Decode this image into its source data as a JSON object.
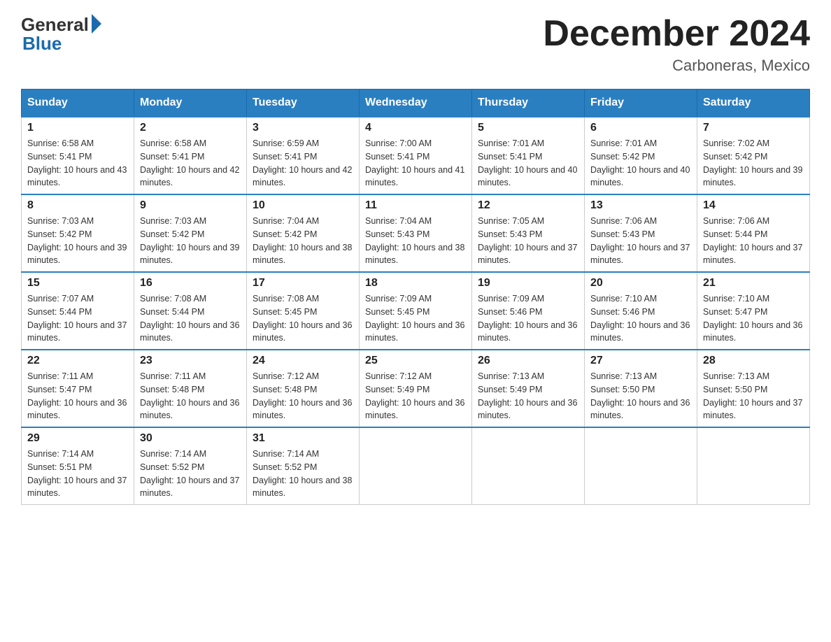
{
  "logo": {
    "general": "General",
    "blue": "Blue"
  },
  "title": "December 2024",
  "subtitle": "Carboneras, Mexico",
  "days_of_week": [
    "Sunday",
    "Monday",
    "Tuesday",
    "Wednesday",
    "Thursday",
    "Friday",
    "Saturday"
  ],
  "weeks": [
    [
      {
        "day": "1",
        "sunrise": "6:58 AM",
        "sunset": "5:41 PM",
        "daylight": "10 hours and 43 minutes."
      },
      {
        "day": "2",
        "sunrise": "6:58 AM",
        "sunset": "5:41 PM",
        "daylight": "10 hours and 42 minutes."
      },
      {
        "day": "3",
        "sunrise": "6:59 AM",
        "sunset": "5:41 PM",
        "daylight": "10 hours and 42 minutes."
      },
      {
        "day": "4",
        "sunrise": "7:00 AM",
        "sunset": "5:41 PM",
        "daylight": "10 hours and 41 minutes."
      },
      {
        "day": "5",
        "sunrise": "7:01 AM",
        "sunset": "5:41 PM",
        "daylight": "10 hours and 40 minutes."
      },
      {
        "day": "6",
        "sunrise": "7:01 AM",
        "sunset": "5:42 PM",
        "daylight": "10 hours and 40 minutes."
      },
      {
        "day": "7",
        "sunrise": "7:02 AM",
        "sunset": "5:42 PM",
        "daylight": "10 hours and 39 minutes."
      }
    ],
    [
      {
        "day": "8",
        "sunrise": "7:03 AM",
        "sunset": "5:42 PM",
        "daylight": "10 hours and 39 minutes."
      },
      {
        "day": "9",
        "sunrise": "7:03 AM",
        "sunset": "5:42 PM",
        "daylight": "10 hours and 39 minutes."
      },
      {
        "day": "10",
        "sunrise": "7:04 AM",
        "sunset": "5:42 PM",
        "daylight": "10 hours and 38 minutes."
      },
      {
        "day": "11",
        "sunrise": "7:04 AM",
        "sunset": "5:43 PM",
        "daylight": "10 hours and 38 minutes."
      },
      {
        "day": "12",
        "sunrise": "7:05 AM",
        "sunset": "5:43 PM",
        "daylight": "10 hours and 37 minutes."
      },
      {
        "day": "13",
        "sunrise": "7:06 AM",
        "sunset": "5:43 PM",
        "daylight": "10 hours and 37 minutes."
      },
      {
        "day": "14",
        "sunrise": "7:06 AM",
        "sunset": "5:44 PM",
        "daylight": "10 hours and 37 minutes."
      }
    ],
    [
      {
        "day": "15",
        "sunrise": "7:07 AM",
        "sunset": "5:44 PM",
        "daylight": "10 hours and 37 minutes."
      },
      {
        "day": "16",
        "sunrise": "7:08 AM",
        "sunset": "5:44 PM",
        "daylight": "10 hours and 36 minutes."
      },
      {
        "day": "17",
        "sunrise": "7:08 AM",
        "sunset": "5:45 PM",
        "daylight": "10 hours and 36 minutes."
      },
      {
        "day": "18",
        "sunrise": "7:09 AM",
        "sunset": "5:45 PM",
        "daylight": "10 hours and 36 minutes."
      },
      {
        "day": "19",
        "sunrise": "7:09 AM",
        "sunset": "5:46 PM",
        "daylight": "10 hours and 36 minutes."
      },
      {
        "day": "20",
        "sunrise": "7:10 AM",
        "sunset": "5:46 PM",
        "daylight": "10 hours and 36 minutes."
      },
      {
        "day": "21",
        "sunrise": "7:10 AM",
        "sunset": "5:47 PM",
        "daylight": "10 hours and 36 minutes."
      }
    ],
    [
      {
        "day": "22",
        "sunrise": "7:11 AM",
        "sunset": "5:47 PM",
        "daylight": "10 hours and 36 minutes."
      },
      {
        "day": "23",
        "sunrise": "7:11 AM",
        "sunset": "5:48 PM",
        "daylight": "10 hours and 36 minutes."
      },
      {
        "day": "24",
        "sunrise": "7:12 AM",
        "sunset": "5:48 PM",
        "daylight": "10 hours and 36 minutes."
      },
      {
        "day": "25",
        "sunrise": "7:12 AM",
        "sunset": "5:49 PM",
        "daylight": "10 hours and 36 minutes."
      },
      {
        "day": "26",
        "sunrise": "7:13 AM",
        "sunset": "5:49 PM",
        "daylight": "10 hours and 36 minutes."
      },
      {
        "day": "27",
        "sunrise": "7:13 AM",
        "sunset": "5:50 PM",
        "daylight": "10 hours and 36 minutes."
      },
      {
        "day": "28",
        "sunrise": "7:13 AM",
        "sunset": "5:50 PM",
        "daylight": "10 hours and 37 minutes."
      }
    ],
    [
      {
        "day": "29",
        "sunrise": "7:14 AM",
        "sunset": "5:51 PM",
        "daylight": "10 hours and 37 minutes."
      },
      {
        "day": "30",
        "sunrise": "7:14 AM",
        "sunset": "5:52 PM",
        "daylight": "10 hours and 37 minutes."
      },
      {
        "day": "31",
        "sunrise": "7:14 AM",
        "sunset": "5:52 PM",
        "daylight": "10 hours and 38 minutes."
      },
      null,
      null,
      null,
      null
    ]
  ]
}
